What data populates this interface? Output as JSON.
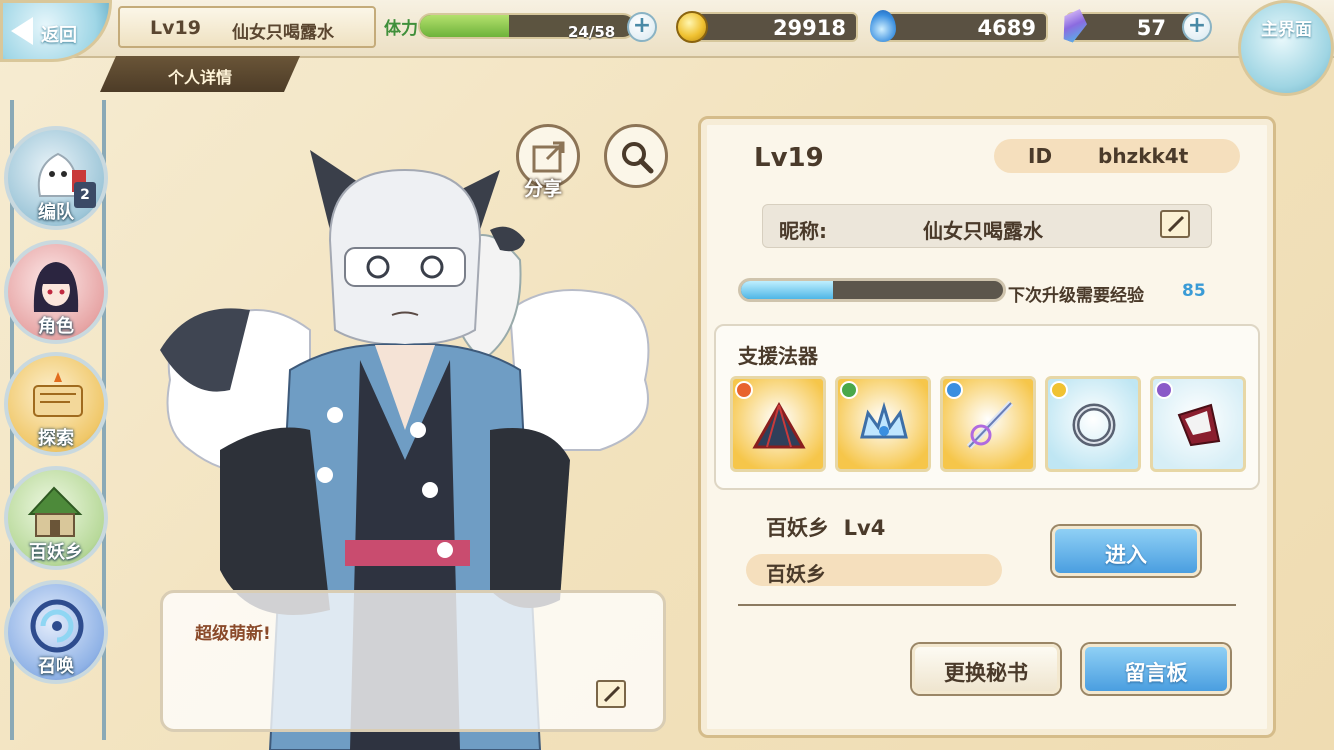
{
  "header": {
    "back_label": "返回",
    "player_level": "Lv19",
    "player_name": "仙女只喝露水",
    "page_subtitle": "个人详情",
    "main_menu_label": "主界面"
  },
  "resources": {
    "stamina_label": "体力",
    "stamina_text": "24/58",
    "stamina_fraction": 0.414,
    "gold": "29918",
    "spirit": "4689",
    "crystal": "57"
  },
  "sidebar": {
    "items": [
      {
        "label": "编队",
        "badge": "2"
      },
      {
        "label": "角色"
      },
      {
        "label": "探索"
      },
      {
        "label": "百妖乡"
      },
      {
        "label": "召唤"
      }
    ]
  },
  "character": {
    "share_label": "分享",
    "speech_text": "超级萌新!"
  },
  "profile": {
    "level": "Lv19",
    "id_label": "ID",
    "id_value": "bhzkk4t",
    "nickname_label": "昵称:",
    "nickname_value": "仙女只喝露水",
    "exp_fraction": 0.35,
    "exp_text": "下次升级需要经验",
    "exp_value": "85"
  },
  "support": {
    "title": "支援法器",
    "artifacts": [
      {
        "name": "fan-artifact",
        "bg": "#f6c64a",
        "gem": "#e8632e"
      },
      {
        "name": "crown-artifact",
        "bg": "#f6c64a",
        "gem": "#4aa84a"
      },
      {
        "name": "sword-artifact",
        "bg": "#f6c64a",
        "gem": "#3a8fe0"
      },
      {
        "name": "ring-artifact",
        "bg": "#bfe6f3",
        "gem": "#f0c232"
      },
      {
        "name": "cloth-artifact",
        "bg": "#d6eef6",
        "gem": "#8a5ac8"
      }
    ]
  },
  "village": {
    "title": "百妖乡",
    "level": "Lv4",
    "name": "百妖乡",
    "enter_label": "进入"
  },
  "actions": {
    "change_secretary": "更换秘书",
    "message_board": "留言板"
  }
}
